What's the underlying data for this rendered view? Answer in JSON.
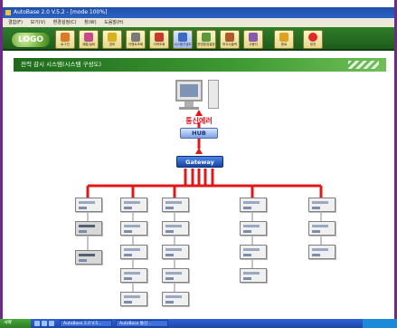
{
  "window": {
    "title": "AutoBase 2.0 V.5.2 - [mode 100%]"
  },
  "menu": {
    "items": [
      "결합(F)",
      "보기(V)",
      "환경설정(C)",
      "창(W)",
      "도움말(H)"
    ]
  },
  "toolbar": {
    "logo": "LOGO",
    "buttons": [
      "로그인",
      "계통/설비",
      "경보",
      "이벤트조회",
      "이력조회",
      "시스템구성도",
      "운영환경설정",
      "보고서출력",
      "사용자",
      "종료",
      "정지"
    ]
  },
  "panel": {
    "title": "전력 감시 시스템(시스템 구성도)"
  },
  "diagram": {
    "status_label": "통신에러",
    "hub_label": "HUB",
    "gateway_label": "Gateway"
  },
  "taskbar": {
    "start_label": "시작",
    "tasks": [
      "AutoBase 2.0 V.5...",
      "AutoBase 통신..."
    ]
  }
}
